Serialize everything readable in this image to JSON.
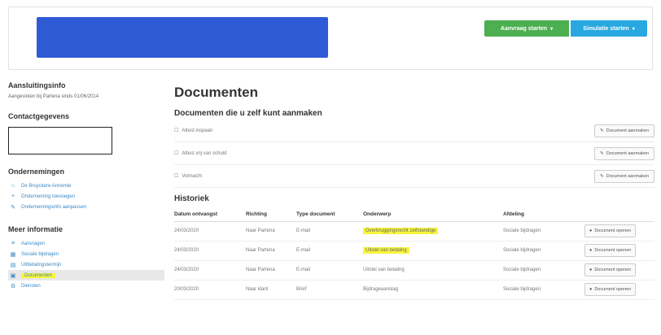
{
  "header": {
    "btn_green": "Aanvraag starten",
    "btn_blue": "Simulatie starten",
    "caret": "▾"
  },
  "sidebar": {
    "aansluiting_title": "Aansluitingsinfo",
    "aansluiting_sub": "Aangesloten bij Partena sinds 01/06/2014",
    "contact_title": "Contactgegevens",
    "ondernemingen_title": "Ondernemingen",
    "ondernemingen_items": [
      {
        "label": "De Bruyckere Annemie",
        "icon": "home-icon"
      },
      {
        "label": "Onderneming toevoegen",
        "icon": "plus-icon"
      },
      {
        "label": "Ondernemingsinfo aanpassen",
        "icon": "wrench-icon"
      }
    ],
    "meer_title": "Meer informatie",
    "meer_items": [
      {
        "label": "Aanvragen",
        "icon": "list-icon"
      },
      {
        "label": "Sociale bijdragen",
        "icon": "calendar-icon"
      },
      {
        "label": "Uitbetalingstermijn",
        "icon": "grid-icon"
      },
      {
        "label": "Documenten",
        "icon": "document-icon"
      },
      {
        "label": "Diensten",
        "icon": "gear-icon"
      }
    ]
  },
  "main": {
    "title": "Documenten",
    "own_docs_title": "Documenten die u zelf kunt aanmaken",
    "docs": [
      {
        "label": "Attest inspaan"
      },
      {
        "label": "Attest vrij van schuld"
      },
      {
        "label": "Volmacht"
      }
    ],
    "create_label": "Document aanmaken",
    "hist_title": "Historiek",
    "hist_headers": [
      "Datum ontvangst",
      "Richting",
      "Type document",
      "Onderwerp",
      "Afdeling",
      ""
    ],
    "rows": [
      {
        "date": "24/03/2020",
        "dir": "Naar Partena",
        "type": "E-mail",
        "subject": "Overbruggingsrecht zelfstandige",
        "dept": "Sociale bijdragen",
        "hl": true
      },
      {
        "date": "24/03/2020",
        "dir": "Naar Partena",
        "type": "E-mail",
        "subject": "Uitstel van betaling",
        "dept": "Sociale bijdragen",
        "hl": true
      },
      {
        "date": "24/03/2020",
        "dir": "Naar Partena",
        "type": "E-mail",
        "subject": "Uitstel van betaling",
        "dept": "Sociale bijdragen",
        "hl": false
      },
      {
        "date": "20/03/2020",
        "dir": "Naar klant",
        "type": "Brief",
        "subject": "Bijdrageaanslag",
        "dept": "Sociale bijdragen",
        "hl": false
      }
    ],
    "open_label": "Document openen"
  }
}
